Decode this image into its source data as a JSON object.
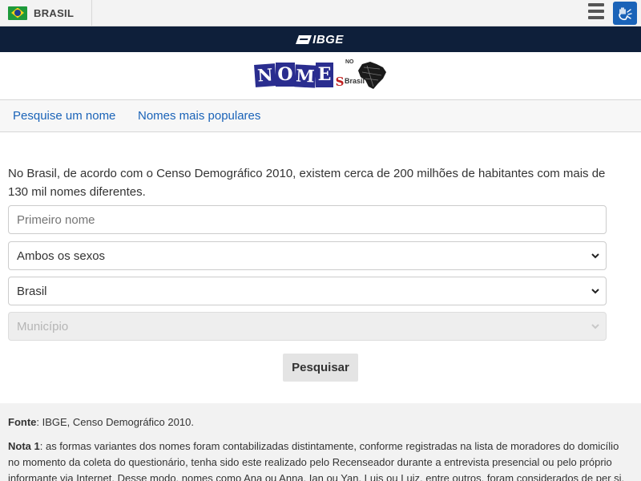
{
  "govbar": {
    "country": "BRASIL",
    "flag_icon": "brazil-flag-icon",
    "menu_icon": "hamburger-icon",
    "accessibility_icon": "sign-language-icon",
    "accessibility_color": "#1a63b8"
  },
  "ibgebar": {
    "logo_text": "IBGE",
    "background": "#0e1f3a"
  },
  "brand": {
    "logo_letters": [
      "N",
      "O",
      "M",
      "E",
      "S"
    ],
    "logo_small_top": "NO",
    "logo_small_side": "Brasil"
  },
  "nav": {
    "items": [
      "Pesquise um nome",
      "Nomes mais populares"
    ],
    "link_color": "#1a63b8"
  },
  "main": {
    "intro": "No Brasil, de acordo com o Censo Demográfico 2010, existem cerca de 200 milhões de habitantes com mais de 130 mil nomes diferentes.",
    "name_placeholder": "Primeiro nome",
    "sex_select": "Ambos os sexos",
    "region_select": "Brasil",
    "city_select": "Município",
    "search_button": "Pesquisar"
  },
  "notes": {
    "source_label": "Fonte",
    "source_text": ": IBGE, Censo Demográfico 2010.",
    "note1_label": "Nota 1",
    "note1_text": ": as formas variantes dos nomes foram contabilizadas distintamente, conforme registradas na lista de moradores do domicílio no momento da coleta do questionário, tenha sido este realizado pelo Recenseador durante a entrevista presencial ou pelo próprio informante via Internet. Desse modo, nomes como Ana ou Anna, Ian ou Yan, Luis ou Luiz, entre outros, foram considerados de per si, com a grafia"
  }
}
